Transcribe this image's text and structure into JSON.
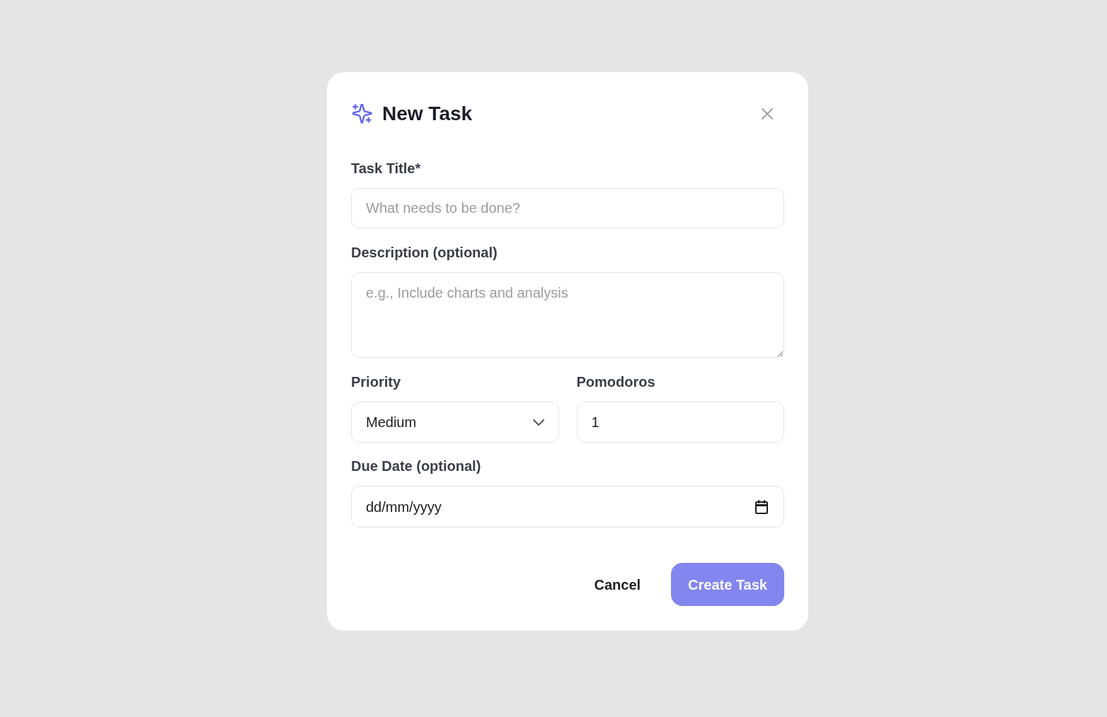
{
  "dialog": {
    "title": "New Task",
    "fields": [
      {
        "kind": "text",
        "label": "Task Title*",
        "placeholder": "What needs to be done?"
      },
      {
        "kind": "textarea",
        "label": "Description (optional)",
        "placeholder": "e.g., Include charts and analysis"
      }
    ],
    "row_fields": [
      {
        "kind": "select",
        "label": "Priority",
        "value": "Medium"
      },
      {
        "kind": "number",
        "label": "Pomodoros",
        "value": "1"
      }
    ],
    "due_date": {
      "label": "Due Date (optional)",
      "placeholder": "dd/mm/yyyy"
    },
    "buttons": [
      {
        "kind": "secondary",
        "label": "Cancel"
      },
      {
        "kind": "primary",
        "label": "Create Task"
      }
    ]
  }
}
